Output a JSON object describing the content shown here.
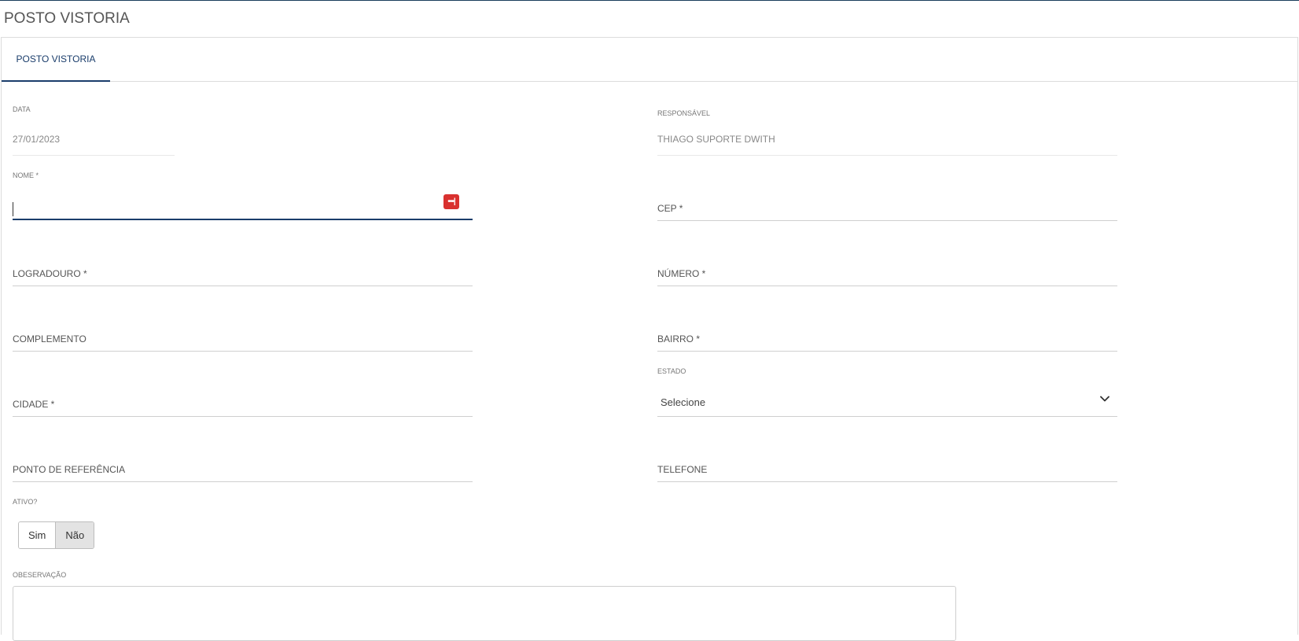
{
  "page": {
    "title": "POSTO VISTORIA"
  },
  "tabs": [
    {
      "label": "POSTO VISTORIA",
      "active": true
    }
  ],
  "form": {
    "data": {
      "label": "DATA",
      "value": "27/01/2023"
    },
    "responsavel": {
      "label": "RESPONSÁVEL",
      "value": "THIAGO SUPORTE DWITH"
    },
    "nome": {
      "label": "NOME *",
      "value": ""
    },
    "cep": {
      "label": "CEP *",
      "value": ""
    },
    "logradouro": {
      "label": "LOGRADOURO *",
      "value": ""
    },
    "numero": {
      "label": "NÚMERO *",
      "value": ""
    },
    "complemento": {
      "label": "COMPLEMENTO",
      "value": ""
    },
    "bairro": {
      "label": "BAIRRO *",
      "value": ""
    },
    "cidade": {
      "label": "CIDADE *",
      "value": ""
    },
    "estado": {
      "label": "ESTADO",
      "value": "Selecione"
    },
    "ponto_referencia": {
      "label": "PONTO DE REFERÊNCIA",
      "value": ""
    },
    "telefone": {
      "label": "TELEFONE",
      "value": ""
    },
    "ativo": {
      "label": "ATIVO?",
      "options": [
        "Sim",
        "Não"
      ],
      "selected": "Não"
    },
    "observacao": {
      "label": "OBESERVAÇÃO",
      "value": ""
    }
  },
  "colors": {
    "accent": "#1a3d6b",
    "password_manager_icon": "#d9312f"
  },
  "icons": {
    "password_manager": "password-manager-icon",
    "select_chevron": "chevron-down-icon"
  }
}
